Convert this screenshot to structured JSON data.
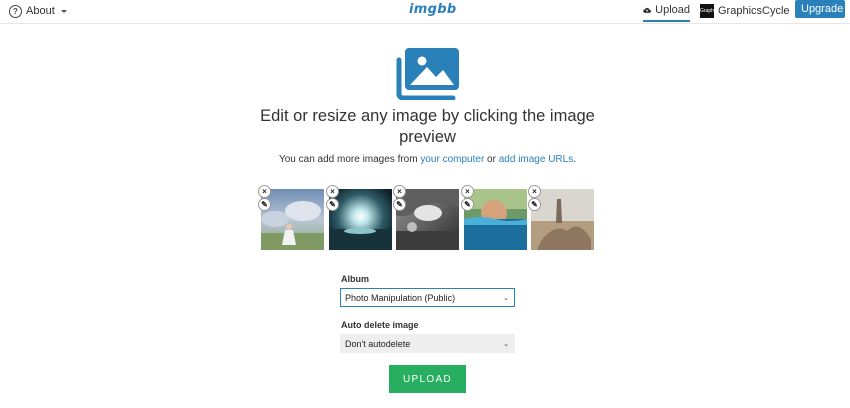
{
  "header": {
    "about_label": "About",
    "logo_text": "imgbb",
    "upload_label": "Upload",
    "user_name": "GraphicsCycle",
    "avatar_text": "Graphi",
    "upgrade_label": "Upgrade"
  },
  "main": {
    "headline": "Edit or resize any image by clicking the image preview",
    "sub_prefix": "You can add more images from ",
    "link_computer": "your computer",
    "sub_middle": " or ",
    "link_urls": "add image URLs",
    "sub_suffix": "."
  },
  "thumbnails": [
    {
      "alt": "Girl in fairy garden"
    },
    {
      "alt": "Glowing light over sea"
    },
    {
      "alt": "Black and white cave scene"
    },
    {
      "alt": "Face emerging from water"
    },
    {
      "alt": "Sculpture on sand"
    }
  ],
  "form": {
    "album_label": "Album",
    "album_value": "Photo Manipulation (Public)",
    "auto_delete_label": "Auto delete image",
    "auto_delete_value": "Don't autodelete",
    "upload_button": "UPLOAD"
  },
  "colors": {
    "accent": "#2a80b9",
    "upload_green": "#27ae60"
  },
  "icons": {
    "about": "help-circle-icon",
    "upload": "cloud-upload-icon",
    "hero": "image-gallery-icon",
    "remove": "close-icon",
    "edit": "edit-icon",
    "dropdown": "chevron-down-icon"
  }
}
